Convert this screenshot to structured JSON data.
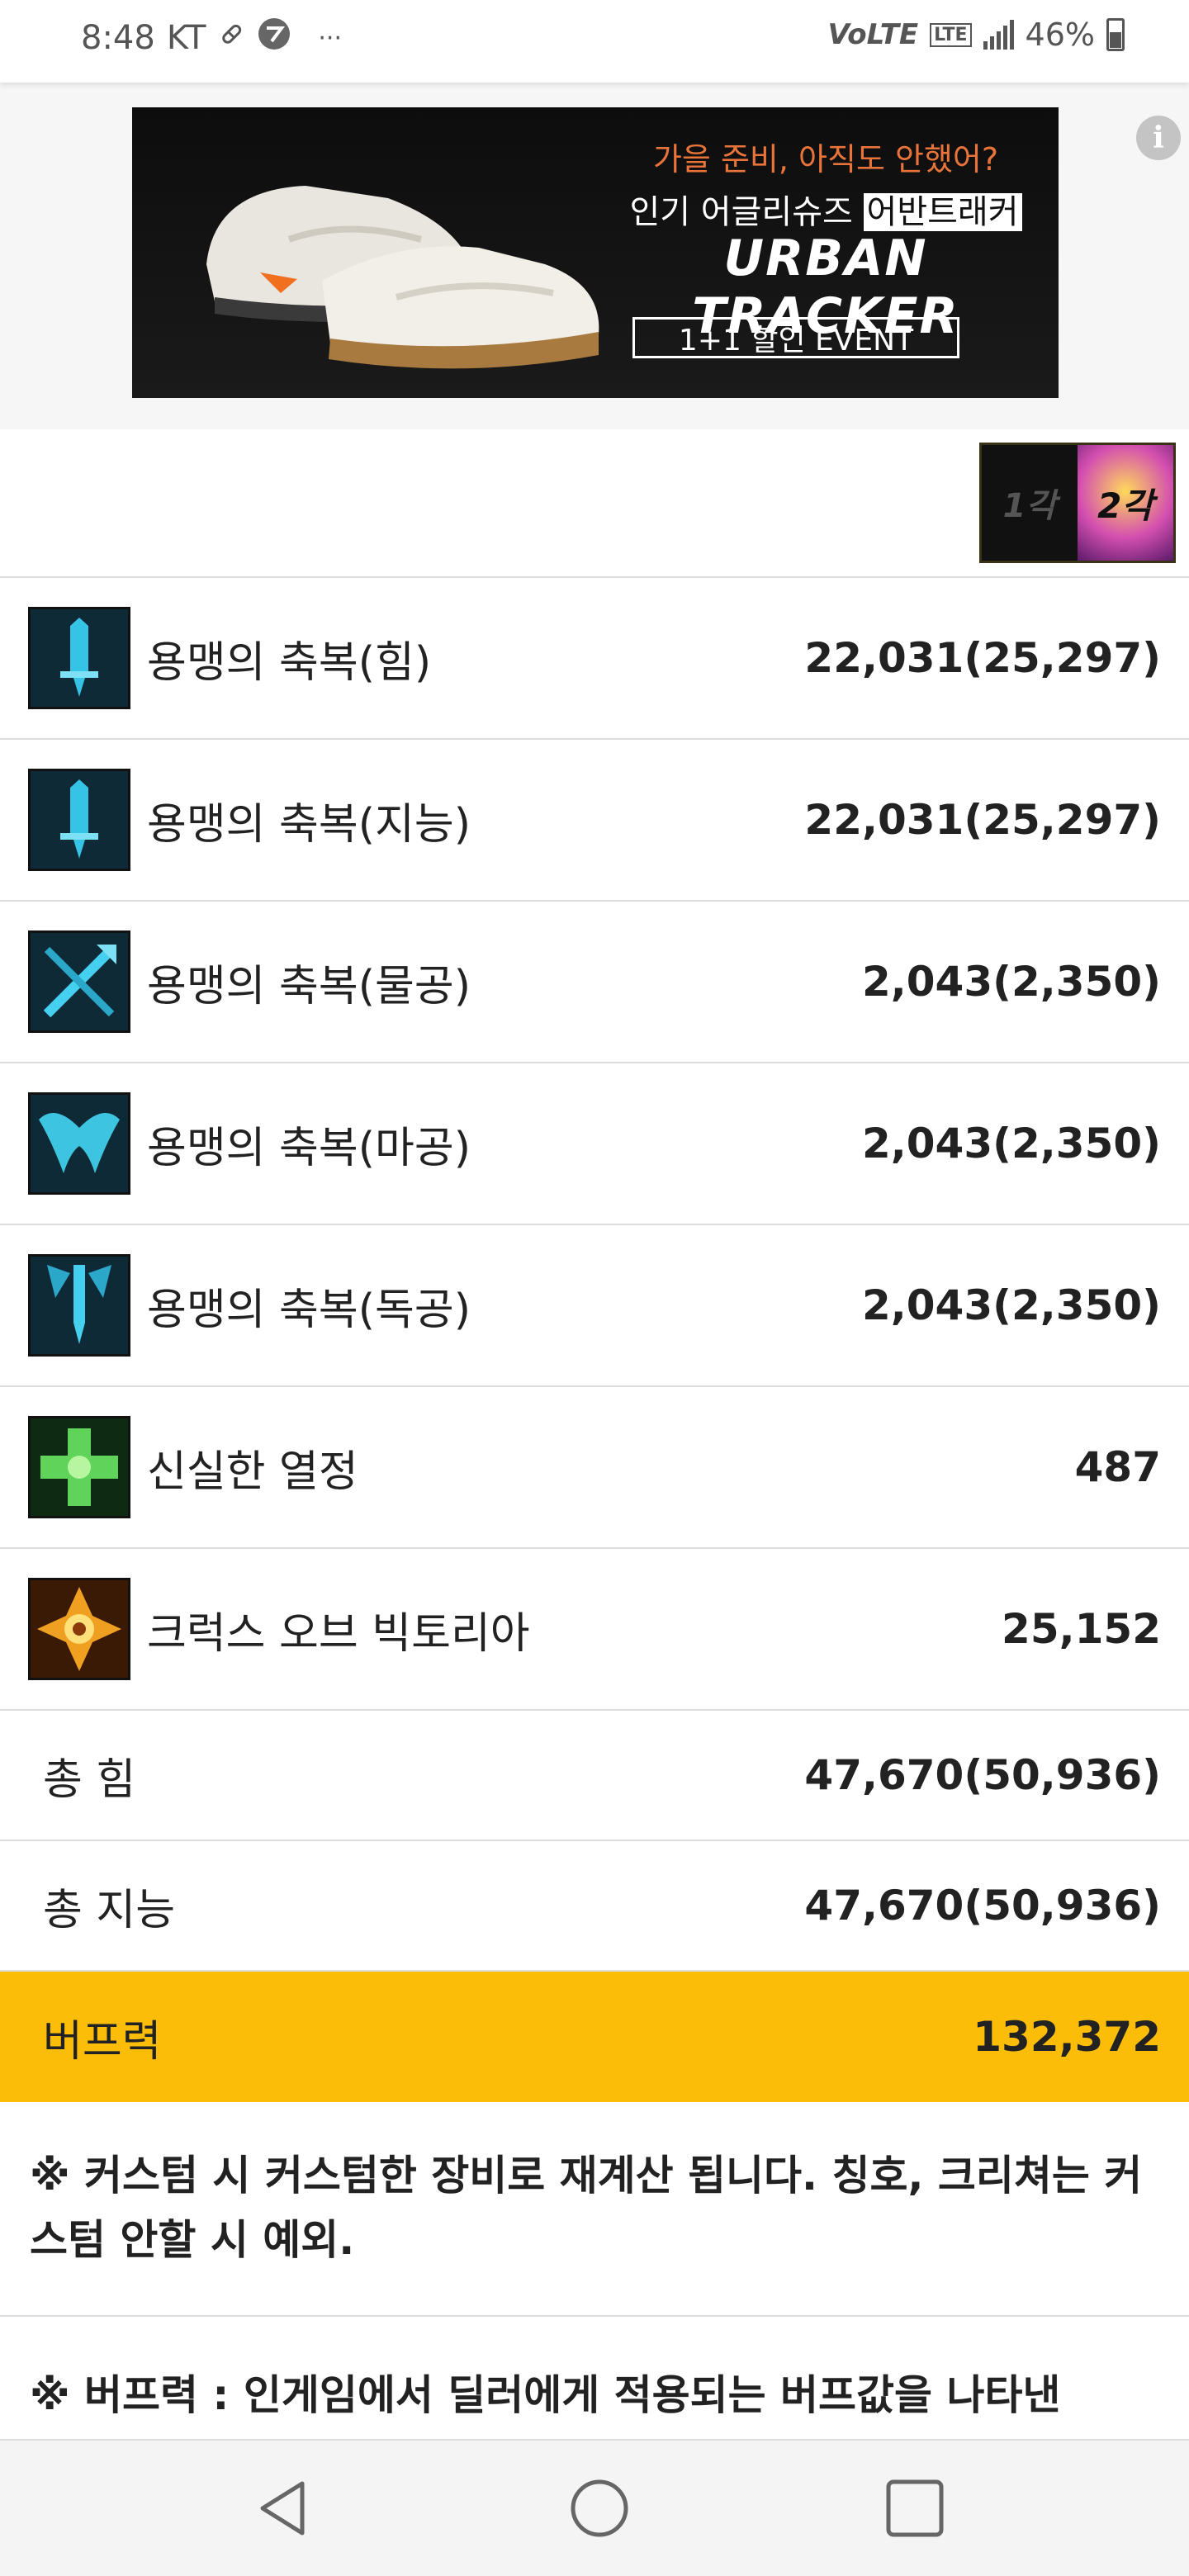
{
  "status_bar": {
    "time": "8:48",
    "carrier": "KT",
    "more": "···",
    "network": "VoLTE",
    "lte": "LTE",
    "battery": "46%"
  },
  "ad": {
    "line1": "가을 준비, 아직도 안했어?",
    "line2_prefix": "인기 어글리슈즈 ",
    "line2_highlight": "어반트래커",
    "line3": "URBAN TRACKER",
    "button": "1+1 할인 EVENT"
  },
  "awakening_toggle": {
    "first": "1각",
    "second": "2각",
    "selected": "2각"
  },
  "buffs": [
    {
      "name": "용맹의 축복(힘)",
      "value": "22,031(25,297)",
      "icon": "sword-down-icon",
      "color": "#2aa7c9"
    },
    {
      "name": "용맹의 축복(지능)",
      "value": "22,031(25,297)",
      "icon": "sword-down-icon",
      "color": "#2aa7c9"
    },
    {
      "name": "용맹의 축복(물공)",
      "value": "2,043(2,350)",
      "icon": "crossed-swords-icon",
      "color": "#2ab6d6"
    },
    {
      "name": "용맹의 축복(마공)",
      "value": "2,043(2,350)",
      "icon": "wings-icon",
      "color": "#3cc4e0"
    },
    {
      "name": "용맹의 축복(독공)",
      "value": "2,043(2,350)",
      "icon": "winged-sword-icon",
      "color": "#2aa7c9"
    },
    {
      "name": "신실한 열정",
      "value": "487",
      "icon": "green-cross-icon",
      "color": "#5fd35a"
    },
    {
      "name": "크럭스 오브 빅토리아",
      "value": "25,152",
      "icon": "golden-cross-icon",
      "color": "#f0a020"
    }
  ],
  "totals": [
    {
      "name": "총 힘",
      "value": "47,670(50,936)"
    },
    {
      "name": "총 지능",
      "value": "47,670(50,936)"
    }
  ],
  "buff_power": {
    "name": "버프력",
    "value": "132,372",
    "color": "#fbbd08"
  },
  "notes": [
    "※ 커스텀 시 커스텀한 장비로 재계산 됩니다. 칭호, 크리쳐는 커스텀 안할 시 예외.",
    "※ 버프력 : 인게임에서 딜러에게 적용되는 버프값을 나타낸"
  ]
}
